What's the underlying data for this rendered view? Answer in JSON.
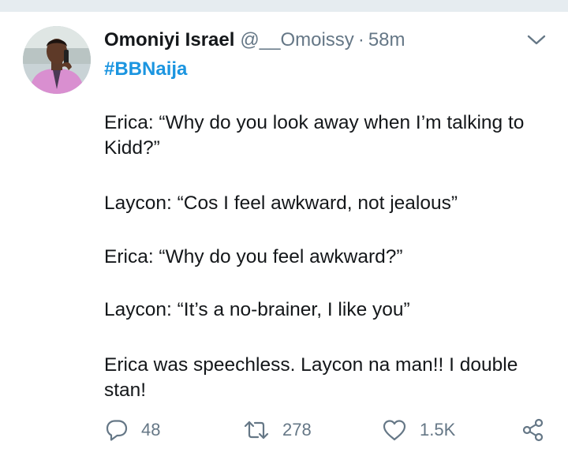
{
  "tweet": {
    "display_name": "Omoniyi Israel",
    "handle": "@__Omoissy",
    "separator": "·",
    "time": "58m",
    "hashtag": "#BBNaija",
    "paragraphs": [
      "Erica: “Why do you look away when I’m talking to Kidd?”",
      "Laycon: “Cos I feel awkward, not jealous”",
      "Erica: “Why do you feel awkward?”",
      "Laycon: “It’s a no-brainer, I like you”",
      "Erica was speechless. Laycon na man!! I double stan!"
    ]
  },
  "actions": {
    "reply_count": "48",
    "retweet_count": "278",
    "like_count": "1.5K"
  },
  "icons": {
    "reply": "speech-bubble-icon",
    "retweet": "retweet-arrows-icon",
    "like": "heart-icon",
    "share": "share-nodes-icon",
    "menu": "chevron-down-icon"
  },
  "colors": {
    "link": "#1b95e0",
    "secondary_text": "#657786",
    "background_strip": "#e6ecf0"
  }
}
